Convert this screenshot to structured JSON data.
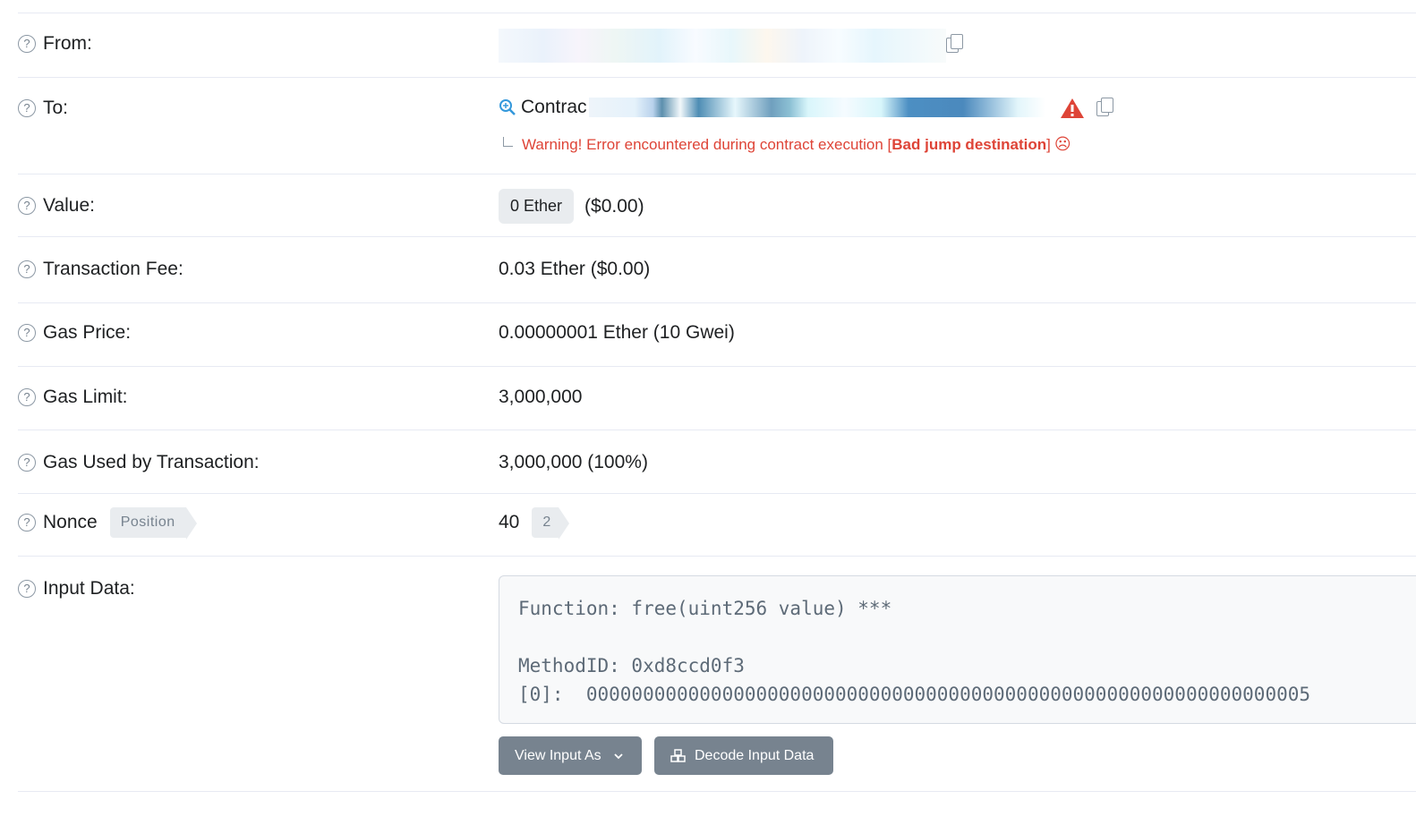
{
  "rows": {
    "from": {
      "label": "From:"
    },
    "to": {
      "label": "To:",
      "contract_prefix": "Contrac",
      "warning_prefix": "Warning! Error encountered during contract execution [",
      "warning_bold": "Bad jump destination",
      "warning_suffix": "]",
      "sad_icon": "☹"
    },
    "value": {
      "label": "Value:",
      "badge": "0 Ether",
      "usd": "($0.00)"
    },
    "fee": {
      "label": "Transaction Fee:",
      "value": "0.03 Ether ($0.00)"
    },
    "gas_price": {
      "label": "Gas Price:",
      "value": "0.00000001 Ether (10 Gwei)"
    },
    "gas_limit": {
      "label": "Gas Limit:",
      "value": "3,000,000"
    },
    "gas_used": {
      "label": "Gas Used by Transaction:",
      "value": "3,000,000 (100%)"
    },
    "nonce": {
      "label": "Nonce",
      "position_tag": "Position",
      "value": "40",
      "position": "2"
    },
    "input": {
      "label": "Input Data:",
      "line1": "Function: free(uint256 value) ***",
      "line2": "",
      "line3": "MethodID: 0xd8ccd0f3",
      "line4": "[0]:  0000000000000000000000000000000000000000000000000000000000000005",
      "view_button": "View Input As",
      "decode_button": "Decode Input Data"
    }
  },
  "icons": {
    "help": "?",
    "copy": "copy-icon",
    "warning": "warning-icon",
    "search": "search-icon"
  },
  "colors": {
    "warning": "#de4437",
    "muted": "#77838f",
    "link": "#3498db"
  }
}
